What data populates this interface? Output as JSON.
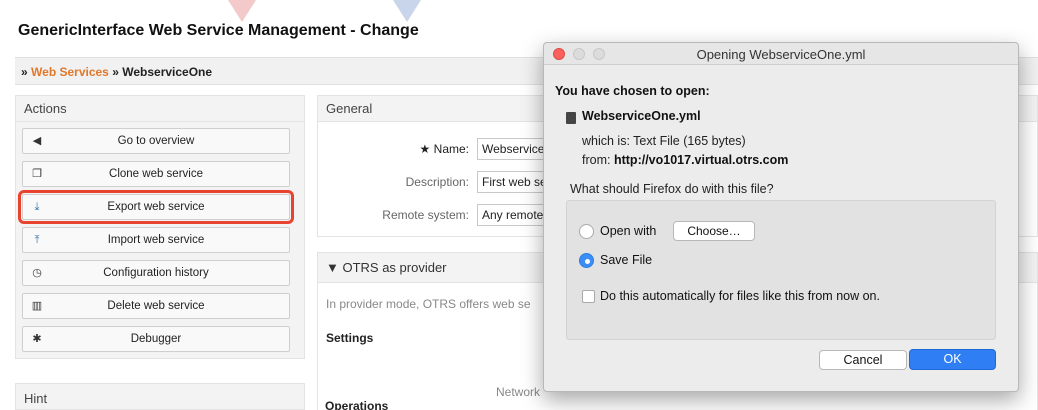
{
  "page": {
    "title": "GenericInterface Web Service Management - Change"
  },
  "breadcrumb": {
    "sep1": "»",
    "link": "Web Services",
    "sep2": "»",
    "current": "WebserviceOne"
  },
  "sidebar": {
    "actions_header": "Actions",
    "actions": [
      {
        "label": "Go to overview",
        "icon": "caret-left-icon"
      },
      {
        "label": "Clone web service",
        "icon": "clone-icon"
      },
      {
        "label": "Export web service",
        "icon": "download-icon",
        "highlighted": true
      },
      {
        "label": "Import web service",
        "icon": "upload-icon"
      },
      {
        "label": "Configuration history",
        "icon": "clock-icon"
      },
      {
        "label": "Delete web service",
        "icon": "trash-icon"
      },
      {
        "label": "Debugger",
        "icon": "bug-icon"
      }
    ],
    "hint_header": "Hint"
  },
  "general": {
    "header": "General",
    "name_label": "Name:",
    "name_required_marker": "★",
    "name_value": "Webservice",
    "description_label": "Description:",
    "description_value": "First web se",
    "remote_label": "Remote system:",
    "remote_value": "Any remote"
  },
  "provider": {
    "header": "▼ OTRS as provider",
    "text": "In provider mode, OTRS offers web se",
    "settings_title": "Settings",
    "network_text": "Network",
    "operations_title": "Operations"
  },
  "dialog": {
    "title": "Opening WebserviceOne.yml",
    "chosen_text": "You have chosen to open:",
    "file_name": "WebserviceOne.yml",
    "which_is": "which is: Text File (165 bytes)",
    "from_label": "from:",
    "from_url": "http://vo1017.virtual.otrs.com",
    "question": "What should Firefox do with this file?",
    "open_with_label": "Open with",
    "choose_label": "Choose…",
    "save_file_label": "Save File",
    "selected_option": "Save File",
    "auto_label": "Do this automatically for files like this from now on.",
    "auto_checked": false,
    "cancel_label": "Cancel",
    "ok_label": "OK"
  },
  "colors": {
    "accent_orange": "#e0782a",
    "highlight_red": "#e8432f",
    "mac_blue": "#2f7ef4"
  }
}
